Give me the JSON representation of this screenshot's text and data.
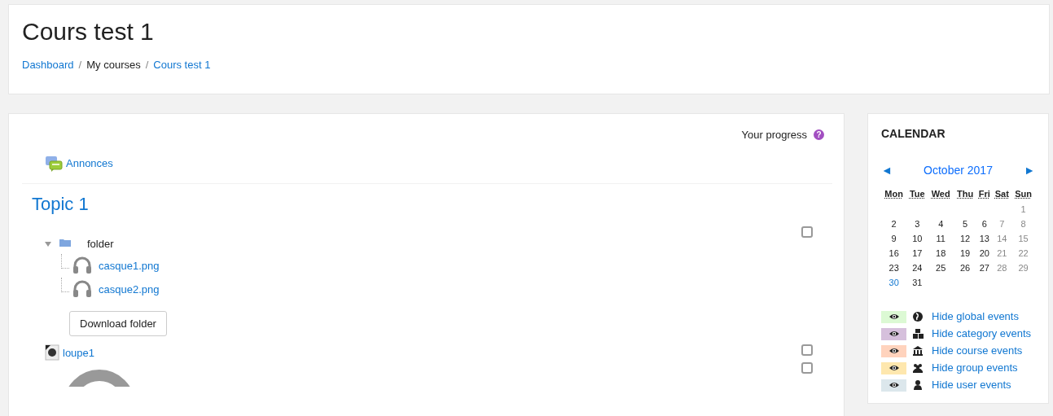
{
  "page_header": {
    "title": "Cours test 1",
    "breadcrumb_separators": [
      "/",
      "/"
    ],
    "breadcrumb": [
      {
        "label": "Dashboard",
        "kind": "link"
      },
      {
        "label": "My courses",
        "kind": "text"
      },
      {
        "label": "Cours test 1",
        "kind": "link"
      }
    ]
  },
  "course": {
    "progress_label": "Your progress",
    "help_icon": "?",
    "intro_activities": [
      {
        "name": "Annonces",
        "kind": "forum"
      }
    ],
    "sections": [
      {
        "title": "Topic 1",
        "activities": [
          {
            "name": "folder",
            "kind": "folder",
            "expanded": true,
            "completed": false,
            "children": [
              {
                "name": "casque1.png"
              },
              {
                "name": "casque2.png"
              }
            ],
            "button": "Download folder"
          },
          {
            "name": "loupe1",
            "kind": "resource",
            "completed": false
          },
          {
            "kind": "label",
            "completed": false
          }
        ]
      }
    ]
  },
  "calendar": {
    "title": "CALENDAR",
    "prev": "◄",
    "month": "October 2017",
    "next": "►",
    "weekdays": [
      "Mon",
      "Tue",
      "Wed",
      "Thu",
      "Fri",
      "Sat",
      "Sun"
    ],
    "weeks": [
      [
        {
          "day": "1",
          "kind": "weekend"
        }
      ],
      [
        {
          "day": "2",
          "kind": "weekday"
        },
        {
          "day": "3",
          "kind": "weekday"
        },
        {
          "day": "4",
          "kind": "weekday"
        },
        {
          "day": "5",
          "kind": "weekday"
        },
        {
          "day": "6",
          "kind": "weekday"
        },
        {
          "day": "7",
          "kind": "weekend"
        },
        {
          "day": "8",
          "kind": "weekend"
        }
      ],
      [
        {
          "day": "9",
          "kind": "weekday"
        },
        {
          "day": "10",
          "kind": "weekday"
        },
        {
          "day": "11",
          "kind": "weekday"
        },
        {
          "day": "12",
          "kind": "weekday"
        },
        {
          "day": "13",
          "kind": "weekday"
        },
        {
          "day": "14",
          "kind": "weekend"
        },
        {
          "day": "15",
          "kind": "weekend"
        }
      ],
      [
        {
          "day": "16",
          "kind": "weekday"
        },
        {
          "day": "17",
          "kind": "weekday"
        },
        {
          "day": "18",
          "kind": "weekday"
        },
        {
          "day": "19",
          "kind": "weekday"
        },
        {
          "day": "20",
          "kind": "weekday"
        },
        {
          "day": "21",
          "kind": "weekend"
        },
        {
          "day": "22",
          "kind": "weekend"
        }
      ],
      [
        {
          "day": "23",
          "kind": "weekday"
        },
        {
          "day": "24",
          "kind": "weekday"
        },
        {
          "day": "25",
          "kind": "weekday"
        },
        {
          "day": "26",
          "kind": "weekday"
        },
        {
          "day": "27",
          "kind": "weekday"
        },
        {
          "day": "28",
          "kind": "weekend"
        },
        {
          "day": "29",
          "kind": "weekend"
        }
      ],
      [
        {
          "day": "30",
          "kind": "today"
        },
        {
          "day": "31",
          "kind": "weekday"
        }
      ]
    ],
    "event_filters": [
      {
        "label": "Hide global events",
        "kind": "global",
        "color": "#dcf9d4"
      },
      {
        "label": "Hide category events",
        "kind": "category",
        "color": "#d6c0dc"
      },
      {
        "label": "Hide course events",
        "kind": "course",
        "color": "#ffd3bd"
      },
      {
        "label": "Hide group events",
        "kind": "group",
        "color": "#fee7ae"
      },
      {
        "label": "Hide user events",
        "kind": "user",
        "color": "#dce7ec"
      }
    ]
  }
}
